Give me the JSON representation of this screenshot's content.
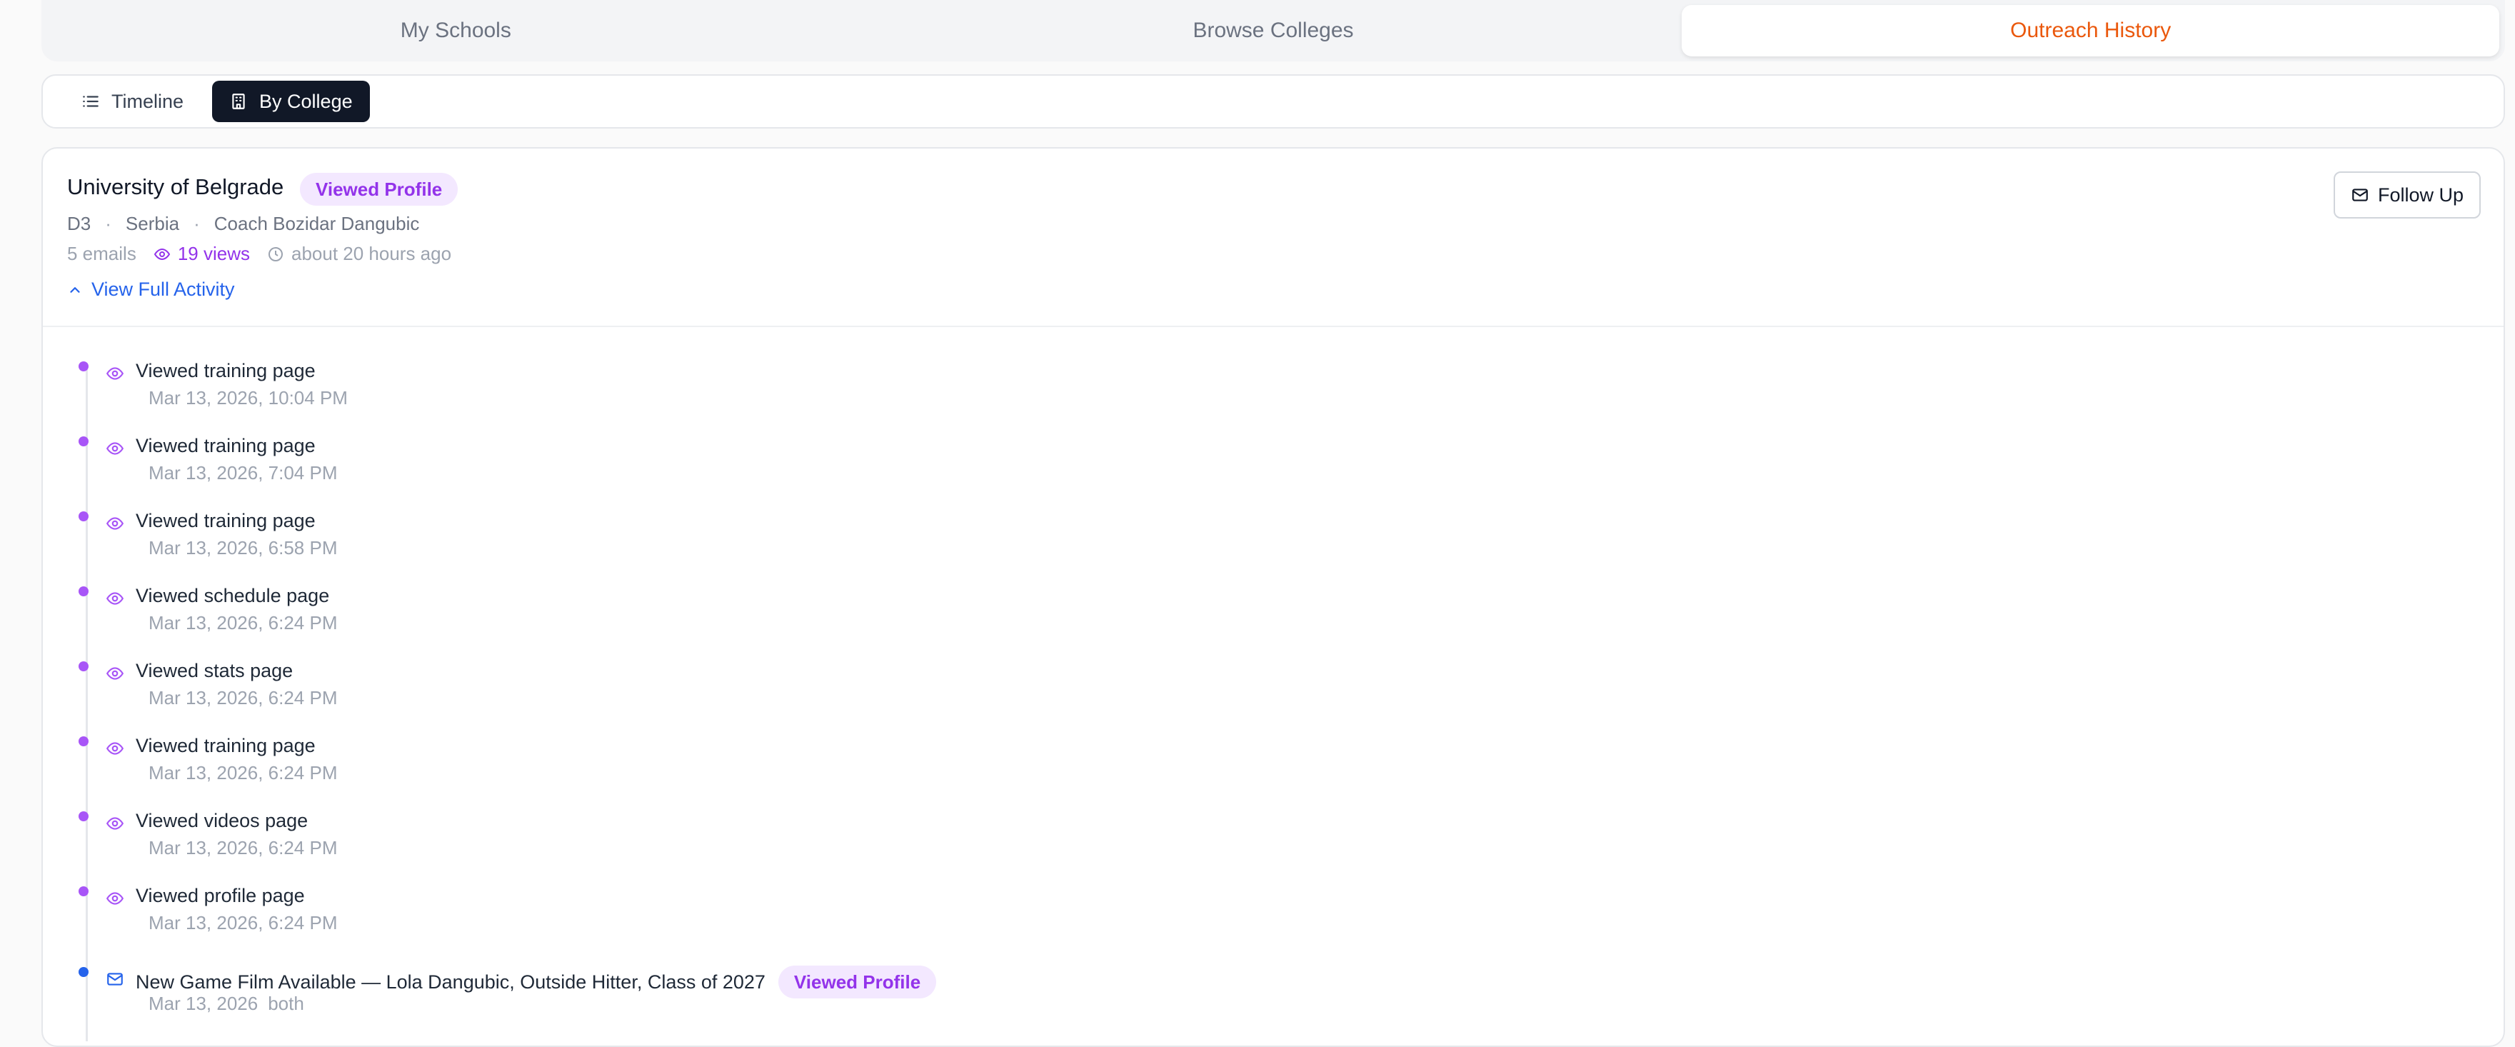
{
  "top_tabs": [
    {
      "label": "My Schools"
    },
    {
      "label": "Browse Colleges"
    },
    {
      "label": "Outreach History"
    }
  ],
  "view_toggle": {
    "timeline_label": "Timeline",
    "by_college_label": "By College"
  },
  "college": {
    "name": "University of Belgrade",
    "badge": "Viewed Profile",
    "division": "D3",
    "country": "Serbia",
    "coach": "Coach Bozidar Dangubic",
    "emails": "5 emails",
    "views": "19 views",
    "last_activity": "about 20 hours ago",
    "view_full_label": "View Full Activity",
    "follow_up_label": "Follow Up"
  },
  "activity": [
    {
      "type": "view",
      "icon": "eye-icon",
      "title": "Viewed training page",
      "date": "Mar 13, 2026, 10:04 PM"
    },
    {
      "type": "view",
      "icon": "eye-icon",
      "title": "Viewed training page",
      "date": "Mar 13, 2026, 7:04 PM"
    },
    {
      "type": "view",
      "icon": "eye-icon",
      "title": "Viewed training page",
      "date": "Mar 13, 2026, 6:58 PM"
    },
    {
      "type": "view",
      "icon": "eye-icon",
      "title": "Viewed schedule page",
      "date": "Mar 13, 2026, 6:24 PM"
    },
    {
      "type": "view",
      "icon": "eye-icon",
      "title": "Viewed stats page",
      "date": "Mar 13, 2026, 6:24 PM"
    },
    {
      "type": "view",
      "icon": "eye-icon",
      "title": "Viewed training page",
      "date": "Mar 13, 2026, 6:24 PM"
    },
    {
      "type": "view",
      "icon": "eye-icon",
      "title": "Viewed videos page",
      "date": "Mar 13, 2026, 6:24 PM"
    },
    {
      "type": "view",
      "icon": "eye-icon",
      "title": "Viewed profile page",
      "date": "Mar 13, 2026, 6:24 PM"
    },
    {
      "type": "email",
      "icon": "mail-icon",
      "title": "New Game Film Available — Lola Dangubic, Outside Hitter, Class of 2027",
      "badge": "Viewed Profile",
      "date": "Mar 13, 2026",
      "extra": "both"
    }
  ],
  "colors": {
    "accent_orange": "#ea580c",
    "purple": "#9333ea",
    "blue": "#2563eb",
    "dark": "#111827"
  }
}
